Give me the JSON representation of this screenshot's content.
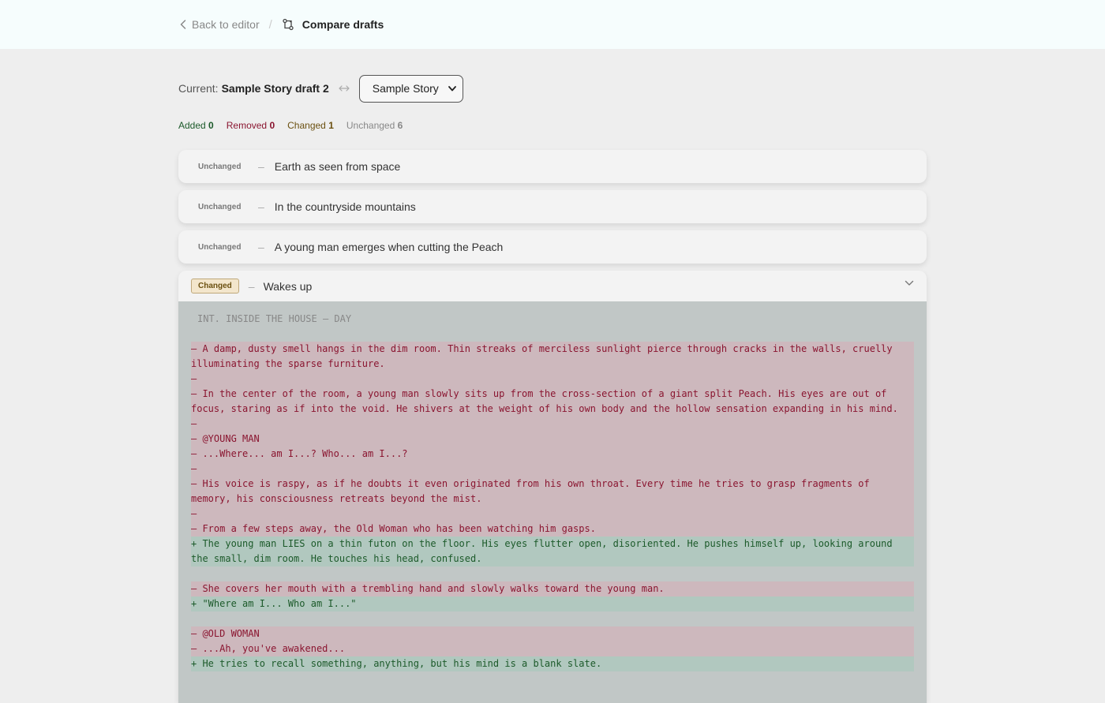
{
  "header": {
    "back_label": "Back to editor",
    "separator": "/",
    "title": "Compare drafts"
  },
  "compare": {
    "current_label": "Current:",
    "current_name": "Sample Story draft 2",
    "select_value": "Sample Story"
  },
  "stats": {
    "added_label": "Added",
    "added_count": "0",
    "removed_label": "Removed",
    "removed_count": "0",
    "changed_label": "Changed",
    "changed_count": "1",
    "unchanged_label": "Unchanged",
    "unchanged_count": "6"
  },
  "rows": [
    {
      "status": "Unchanged",
      "dash": "–",
      "title": "Earth as seen from space"
    },
    {
      "status": "Unchanged",
      "dash": "–",
      "title": "In the countryside mountains"
    },
    {
      "status": "Unchanged",
      "dash": "–",
      "title": "A young man emerges when cutting the Peach"
    }
  ],
  "changed": {
    "status": "Changed",
    "dash": "–",
    "title": "Wakes up",
    "slug": "INT. INSIDE THE HOUSE – DAY",
    "diff": [
      {
        "t": "rem",
        "text": "– A damp, dusty smell hangs in the dim room. Thin streaks of merciless sunlight pierce through cracks in the walls, cruelly illuminating the sparse furniture."
      },
      {
        "t": "rem",
        "text": "–"
      },
      {
        "t": "rem",
        "text": "– In the center of the room, a young man slowly sits up from the cross-section of a giant split Peach. His eyes are out of focus, staring as if into the void. He shivers at the weight of his own body and the hollow sensation expanding in his mind."
      },
      {
        "t": "rem",
        "text": "–"
      },
      {
        "t": "rem",
        "text": "– @YOUNG MAN"
      },
      {
        "t": "rem",
        "text": "– ...Where... am I...? Who... am I...?"
      },
      {
        "t": "rem",
        "text": "–"
      },
      {
        "t": "rem",
        "text": "– His voice is raspy, as if he doubts it even originated from his own throat. Every time he tries to grasp fragments of memory, his consciousness retreats beyond the mist."
      },
      {
        "t": "rem",
        "text": "–"
      },
      {
        "t": "rem",
        "text": "– From a few steps away, the Old Woman who has been watching him gasps."
      },
      {
        "t": "add",
        "text": "+ The young man LIES on a thin futon on the floor. His eyes flutter open, disoriented. He pushes himself up, looking around the small, dim room. He touches his head, confused."
      },
      {
        "t": "gap",
        "text": ""
      },
      {
        "t": "rem",
        "text": "– She covers her mouth with a trembling hand and slowly walks toward the young man."
      },
      {
        "t": "add",
        "text": "+ \"Where am I... Who am I...\""
      },
      {
        "t": "gap",
        "text": ""
      },
      {
        "t": "rem",
        "text": "– @OLD WOMAN"
      },
      {
        "t": "rem",
        "text": "– ...Ah, you've awakened..."
      },
      {
        "t": "add",
        "text": "+ He tries to recall something, anything, but his mind is a blank slate."
      }
    ]
  }
}
